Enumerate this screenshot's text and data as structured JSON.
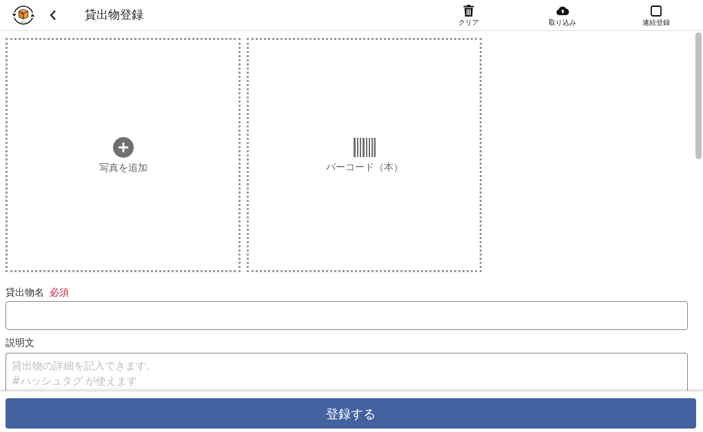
{
  "header": {
    "title": "貸出物登録",
    "actions": [
      {
        "kind": "clear",
        "label": "クリア"
      },
      {
        "kind": "import",
        "label": "取り込み"
      },
      {
        "kind": "checkbox",
        "label": "連続登録",
        "checked": false
      }
    ]
  },
  "media": [
    {
      "kind": "photo",
      "label": "写真を追加"
    },
    {
      "kind": "barcode",
      "label": "バーコード（本）"
    }
  ],
  "form": {
    "fields": [
      {
        "kind": "input",
        "label": "貸出物名",
        "badge": "必須"
      },
      {
        "kind": "textarea",
        "label": "説明文",
        "placeholder": "貸出物の詳細を記入できます。\n#ハッシュタグ が使えます"
      }
    ]
  },
  "submit": {
    "label": "登録する"
  }
}
